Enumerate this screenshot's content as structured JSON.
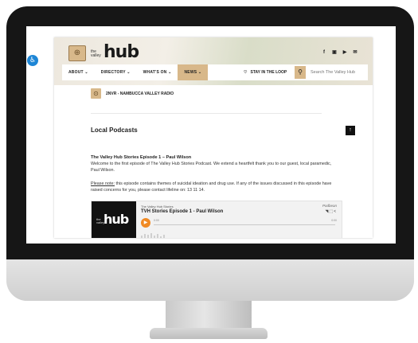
{
  "site": {
    "logo_prefix": "the valley",
    "logo": "hub",
    "social_icons": [
      "f",
      "▣",
      "▶",
      "✉"
    ]
  },
  "nav": {
    "items": [
      "ABOUT",
      "DIRECTORY",
      "WHAT'S ON",
      "NEWS"
    ],
    "stay": "STAY IN THE LOOP",
    "search_placeholder": "Search The Valley Hub"
  },
  "radio": {
    "label": "2NVR - NAMBUCCA VALLEY RADIO"
  },
  "section": {
    "title": "Local Podcasts"
  },
  "episode": {
    "title": "The Valley Hub Stories Episode 1 – Paul Wilson",
    "description": "Welcome to the first episode of The Valley Hub Stories Podcast. We extend a heartfelt thank you to our guest, local paramedic, Paul Wilson.",
    "notice_label": "Please note:",
    "notice_text": " this episode contains themes of suicidal ideation and drug use. If any of the issues discussed in this episode have raised concerns for you, please contact lifeline on: 13 11 14."
  },
  "player": {
    "show": "The Valley Hub Stories",
    "episode": "TVH Stories Episode 1 - Paul Wilson",
    "brand": "Podbean",
    "time_start": "0:00",
    "time_end": "0:00",
    "art_prefix": "the valley",
    "art_logo": "hub"
  }
}
